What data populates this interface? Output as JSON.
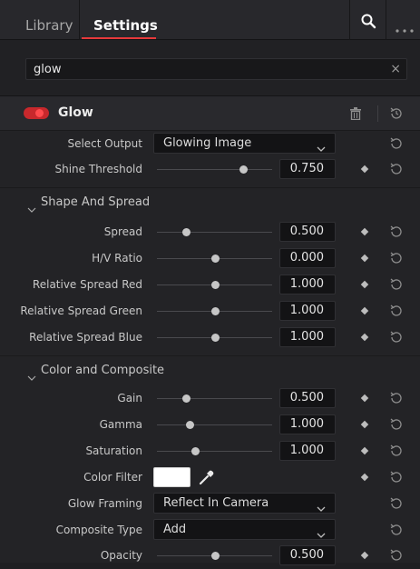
{
  "tabs": {
    "library": "Library",
    "settings": "Settings"
  },
  "search": {
    "value": "glow",
    "clear": "×"
  },
  "effect": {
    "name": "Glow",
    "enabled": true
  },
  "top_rows": {
    "select_output": {
      "label": "Select Output",
      "value": "Glowing Image"
    },
    "shine_threshold": {
      "label": "Shine Threshold",
      "value": "0.750",
      "level": 0.75
    }
  },
  "shape_section": {
    "title": "Shape And Spread",
    "rows": [
      {
        "label": "Spread",
        "value": "0.500",
        "level": 0.25
      },
      {
        "label": "H/V Ratio",
        "value": "0.000",
        "level": 0.5
      },
      {
        "label": "Relative Spread Red",
        "value": "1.000",
        "level": 0.5
      },
      {
        "label": "Relative Spread Green",
        "value": "1.000",
        "level": 0.5
      },
      {
        "label": "Relative Spread Blue",
        "value": "1.000",
        "level": 0.5
      }
    ]
  },
  "color_section": {
    "title": "Color and Composite",
    "gain": {
      "label": "Gain",
      "value": "0.500",
      "level": 0.25
    },
    "gamma": {
      "label": "Gamma",
      "value": "1.000",
      "level": 0.28
    },
    "saturation": {
      "label": "Saturation",
      "value": "1.000",
      "level": 0.33
    },
    "color_filter": {
      "label": "Color Filter",
      "color": "#ffffff"
    },
    "glow_framing": {
      "label": "Glow Framing",
      "value": "Reflect In Camera"
    },
    "composite_type": {
      "label": "Composite Type",
      "value": "Add"
    },
    "opacity": {
      "label": "Opacity",
      "value": "0.500",
      "level": 0.5
    }
  },
  "colors": {
    "accent": "#e6393b",
    "background": "#232326"
  }
}
